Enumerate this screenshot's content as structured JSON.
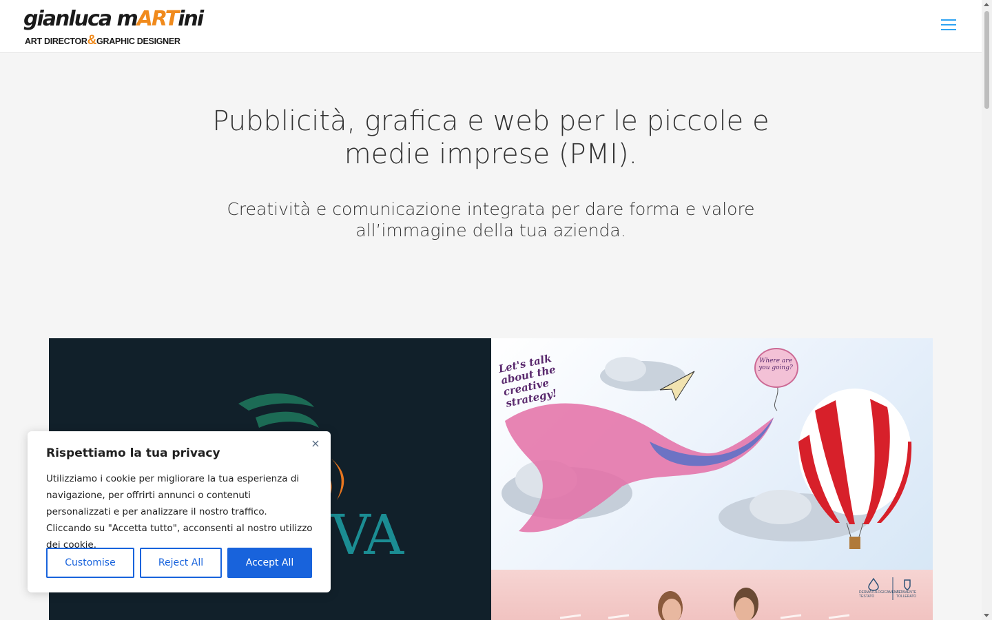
{
  "header": {
    "logo": {
      "name_part1": "gianluca m",
      "name_accent": "ART",
      "name_part2": "ini",
      "tagline_part1": "ART DIRECTOR",
      "tagline_amp": "&",
      "tagline_part2": "GRAPHIC DESIGNER"
    },
    "menu_icon": "hamburger-menu-icon"
  },
  "hero": {
    "title": "Pubblicità, grafica e web per le piccole e medie imprese (PMI).",
    "subtitle": "Creatività e comunicazione integrata per dare forma e valore all’immagine della tua azienda."
  },
  "gallery": {
    "tile_left": {
      "brand_text": "VA"
    },
    "tile_right_top": {
      "callout": "Let's talk about the creative strategy!",
      "bubble": "Where are you going?"
    },
    "tile_right_bottom": {
      "badge_left": "DERMATOLOGICAMENTE TESTATO",
      "badge_right": "ALTAMENTE TOLLERATO"
    }
  },
  "cookie_banner": {
    "title": "Rispettiamo la tua privacy",
    "text": "Utilizziamo i cookie per migliorare la tua esperienza di navigazione, per offrirti annunci o contenuti personalizzati e per analizzare il nostro traffico. Cliccando su \"Accetta tutto\", acconsenti al nostro utilizzo dei cookie.",
    "close_symbol": "×",
    "buttons": {
      "customise": "Customise",
      "reject": "Reject All",
      "accept": "Accept All"
    }
  },
  "colors": {
    "accent_blue": "#2ea3f2",
    "cookie_button_blue": "#1863dc",
    "logo_orange": "#f08a1c",
    "page_background": "#f5f5f5"
  }
}
